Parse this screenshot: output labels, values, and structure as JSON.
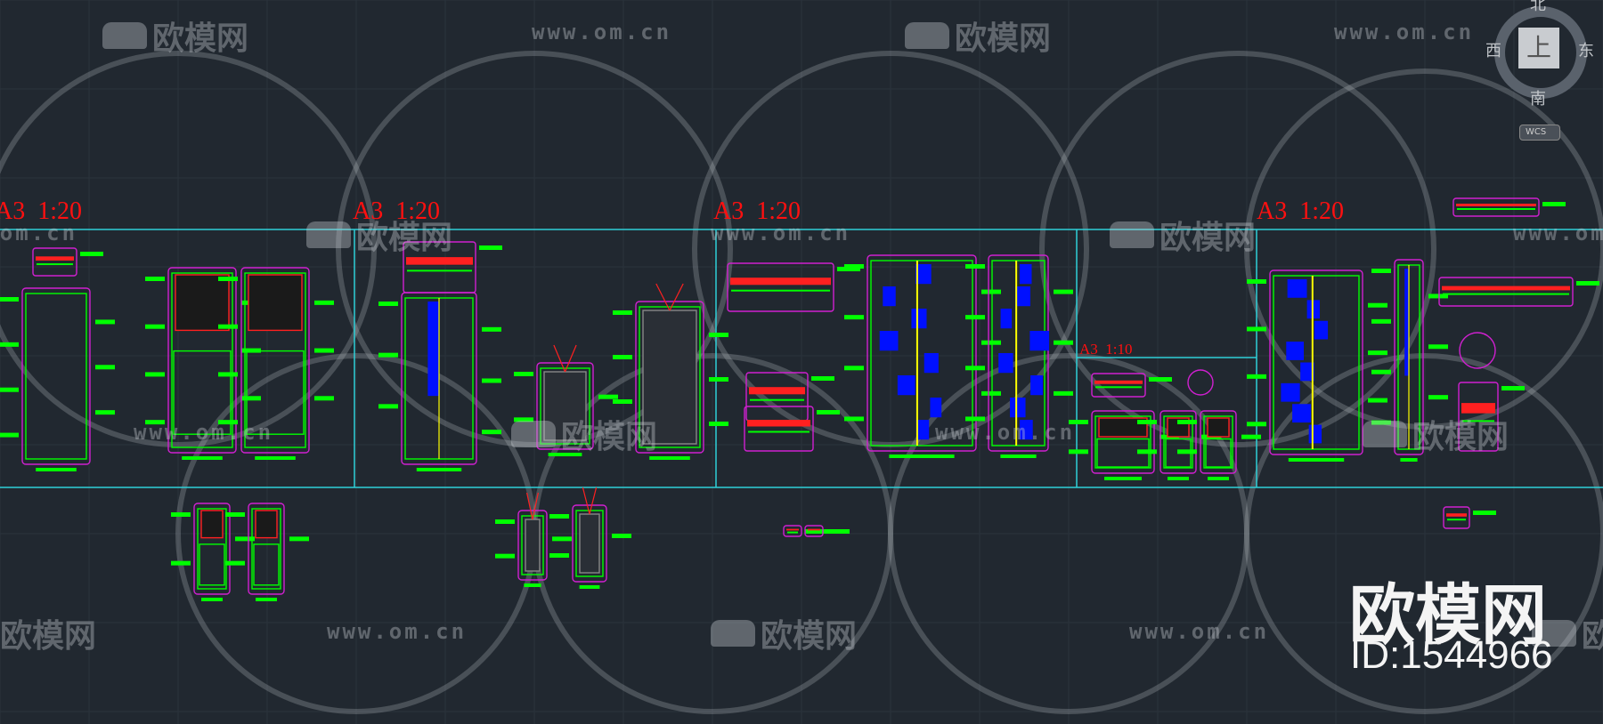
{
  "sheets": [
    {
      "label": "A3  1:20"
    },
    {
      "label": "A3  1:20"
    },
    {
      "label": "A3  1:20"
    },
    {
      "label": "A3  1:10"
    },
    {
      "label": "A3  1:20"
    }
  ],
  "viewcube": {
    "north": "北",
    "south": "南",
    "east": "东",
    "west": "西",
    "face": "上",
    "ucs_menu": "WCS"
  },
  "watermark": {
    "logo_text": "欧模网",
    "url": "www.om.cn",
    "big_text": "欧模网",
    "id": "ID:1544966"
  },
  "colors": {
    "background": "#212830",
    "frame": "#2fd0d8",
    "label": "#ff1010",
    "annotation": "#00ff00",
    "boundary": "#d020d0",
    "fill": "#0010ff"
  }
}
